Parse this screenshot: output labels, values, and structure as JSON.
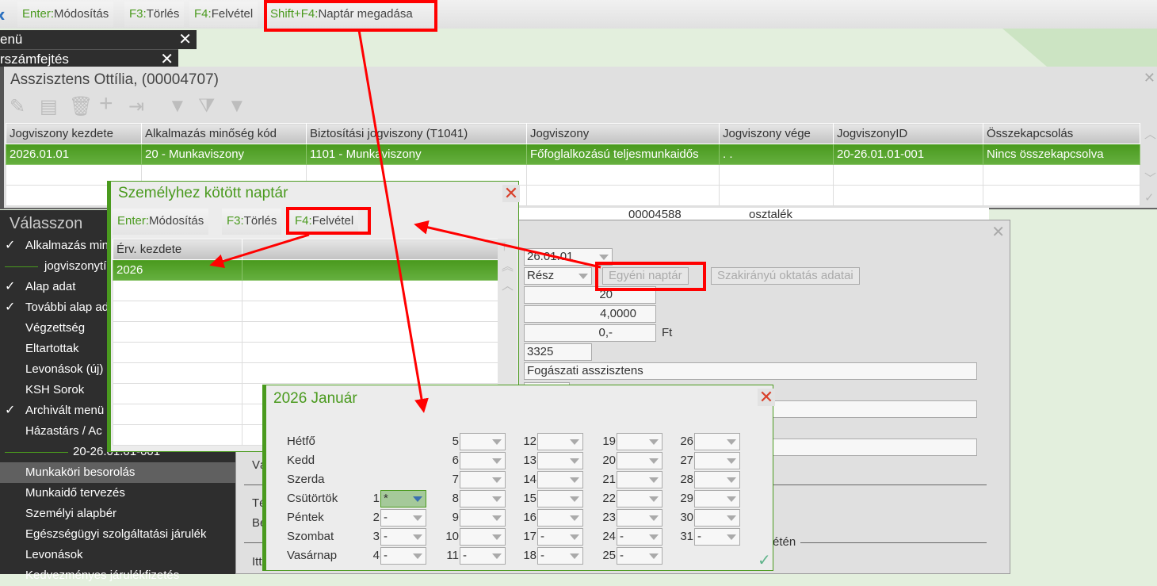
{
  "toolbar": {
    "back_icon": "chevron-left-icon",
    "buttons": [
      {
        "key": "Enter:",
        "label": "Módosítás"
      },
      {
        "key": "F3:",
        "label": "Törlés"
      },
      {
        "key": "F4:",
        "label": "Felvétel"
      },
      {
        "key": "Shift+F4:",
        "label": "Naptár megadása"
      }
    ]
  },
  "tabs": [
    {
      "label": "enü"
    },
    {
      "label": "rszámfejtés"
    }
  ],
  "window": {
    "title": "Asszisztens Ottília, (00004707)",
    "icons": [
      "pencil-icon",
      "edit-document-icon",
      "trash-icon",
      "plus-icon",
      "import-icon",
      "filter-icon",
      "filter-clear-icon",
      "filter-add-icon"
    ],
    "columns": [
      "Jogviszony kezdete",
      "Alkalmazás minőség kód",
      "Biztosítási jogviszony (T1041)",
      "Jogviszony",
      "Jogviszony vége",
      "JogviszonyID",
      "Összekapcsolás"
    ],
    "rows": [
      [
        "2026.01.01",
        "20 - Munkaviszony",
        "1101 - Munkaviszony",
        "Főfoglalkozású teljesmunkaidős",
        ". .",
        "20-26.01.01-001",
        "Nincs összekapcsolva"
      ]
    ]
  },
  "sidebar": {
    "title": "Válasszon",
    "items": [
      {
        "label": "Alkalmazás minőség",
        "checked": true
      },
      {
        "label": "jogviszonytípus",
        "separator": true
      },
      {
        "label": "Alap adat",
        "checked": true
      },
      {
        "label": "További alap adatok",
        "checked": true
      },
      {
        "label": "Végzettség"
      },
      {
        "label": "Eltartottak"
      },
      {
        "label": "Levonások (új)"
      },
      {
        "label": "KSH Sorok"
      },
      {
        "label": "Archivált menü",
        "checked": true
      },
      {
        "label": "Házastárs / Ac"
      },
      {
        "label": "20-26.01.01-001",
        "separator": true
      },
      {
        "label": "Munkaköri besorolás",
        "selected": true
      },
      {
        "label": "Munkaidő tervezés"
      },
      {
        "label": "Személyi alapbér"
      },
      {
        "label": "Egészségügyi szolgáltatási járulék"
      },
      {
        "label": "Levonások"
      },
      {
        "label": "Kedvezményes járulékfizetés"
      }
    ]
  },
  "behind_row": {
    "id": "00004588",
    "type": "osztalék"
  },
  "detail": {
    "date": "26.01.01",
    "mode": "Rész",
    "egyeni_naptar": "Egyéni naptár",
    "szakiranyu": "Szakirányú oktatás adatai",
    "hours": "20",
    "ratio": "4,0000",
    "amount": "0,-",
    "currency": "Ft",
    "feor": "3325",
    "job": "Fogászati asszisztens",
    "labels": [
      "Vá",
      "Té",
      "Bé",
      "Itt"
    ],
    "section_tail": "étén"
  },
  "naptar_dialog": {
    "title": "Személyhez kötött naptár",
    "buttons": [
      {
        "key": "Enter:",
        "label": "Módosítás"
      },
      {
        "key": "F3:",
        "label": "Törlés"
      },
      {
        "key": "F4:",
        "label": "Felvétel"
      }
    ],
    "column": "Érv. kezdete",
    "rows": [
      "2026"
    ]
  },
  "calendar": {
    "title": "2026 Január",
    "weekdays": [
      "Hétfő",
      "Kedd",
      "Szerda",
      "Csütörtök",
      "Péntek",
      "Szombat",
      "Vasárnap"
    ],
    "days": [
      "*",
      "-",
      "-",
      "-",
      "",
      "",
      "",
      "",
      "",
      "",
      "-",
      "",
      "",
      "",
      "",
      "",
      "-",
      "-",
      "",
      "",
      "",
      "",
      "",
      "-",
      "-",
      "",
      "",
      "",
      "",
      "",
      "-"
    ],
    "selected_day": 1
  },
  "colors": {
    "accent": "#4a9a1e",
    "annotation": "#ff0000",
    "sidebar": "#2e2e2e"
  }
}
